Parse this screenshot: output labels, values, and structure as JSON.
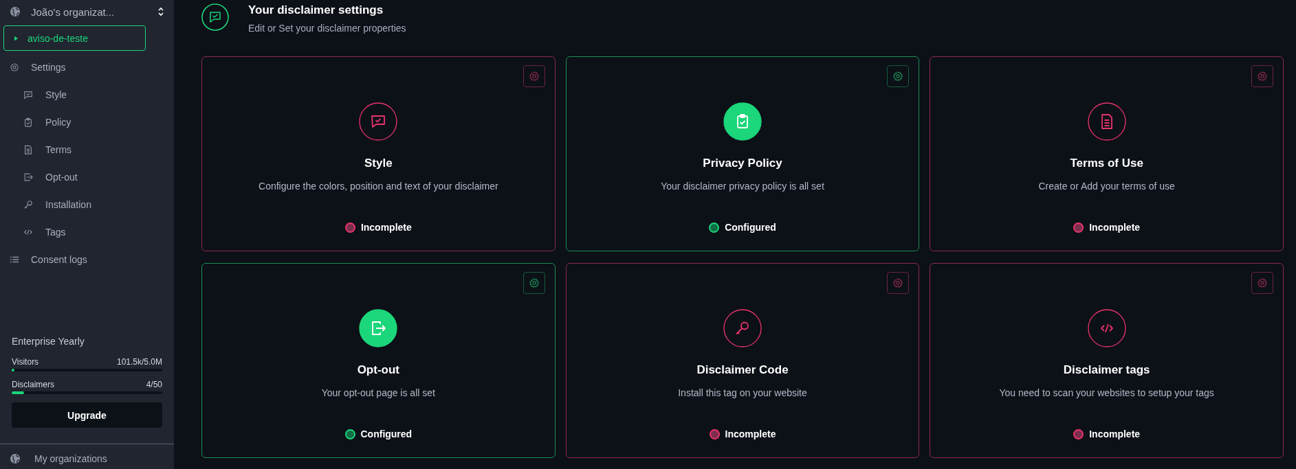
{
  "sidebar": {
    "organization": "João's organizat...",
    "project": {
      "label": "aviso-de-teste",
      "selected": true,
      "expanded": false
    },
    "items": [
      {
        "label": "Settings",
        "selected": false,
        "children": [
          {
            "label": "Style",
            "selected": false
          },
          {
            "label": "Policy",
            "selected": false
          },
          {
            "label": "Terms",
            "selected": false
          },
          {
            "label": "Opt-out",
            "selected": false
          },
          {
            "label": "Installation",
            "selected": false
          },
          {
            "label": "Tags",
            "selected": false
          }
        ]
      },
      {
        "label": "Consent logs",
        "selected": false
      }
    ],
    "plan": {
      "name": "Enterprise Yearly",
      "meters": [
        {
          "label": "Visitors",
          "reading": "101.5k/5.0M",
          "level": 0.02
        },
        {
          "label": "Disclaimers",
          "reading": "4/50",
          "level": 0.08
        }
      ],
      "button": "Upgrade"
    },
    "footer": "My organizations"
  },
  "header": {
    "title": "Your disclaimer settings",
    "subtitle": "Edit or Set your disclaimer properties"
  },
  "cards": [
    {
      "title": "Style",
      "description": "Configure the colors, position and text of your disclaimer",
      "configured": false,
      "status": "Incomplete"
    },
    {
      "title": "Privacy Policy",
      "description": "Your disclaimer privacy policy is all set",
      "configured": true,
      "status": "Configured"
    },
    {
      "title": "Terms of Use",
      "description": "Create or Add your terms of use",
      "configured": false,
      "status": "Incomplete"
    },
    {
      "title": "Opt-out",
      "description": "Your opt-out page is all set",
      "configured": true,
      "status": "Configured"
    },
    {
      "title": "Disclaimer Code",
      "description": "Install this tag on your website",
      "configured": false,
      "status": "Incomplete"
    },
    {
      "title": "Disclaimer tags",
      "description": "You need to scan your websites to setup your tags",
      "configured": false,
      "status": "Incomplete"
    }
  ]
}
